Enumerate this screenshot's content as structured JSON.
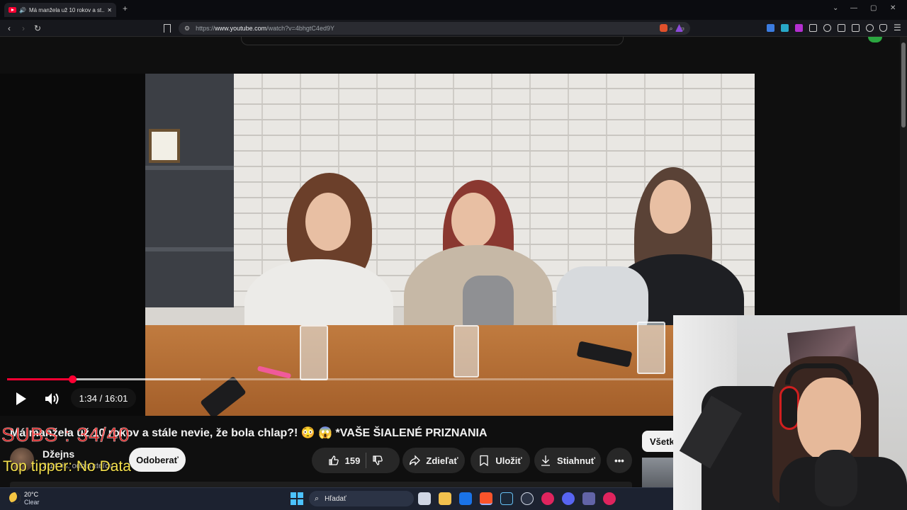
{
  "browser": {
    "tab_title": "Má manžela už 10 rokov a st...",
    "tab_close": "✕",
    "new_tab": "+",
    "url_prefix": "https://",
    "url_host": "www.youtube.com",
    "url_path": "/watch?v=4bhgtC4ed9Y",
    "window_controls": [
      "⌄",
      "—",
      "▢",
      "✕"
    ]
  },
  "player": {
    "time": "1:34 / 16:01",
    "progress": 0.098,
    "buffered": 0.29
  },
  "video": {
    "title": "Má manžela už 10 rokov a stále nevie, že bola chlap?! 😳 😱 *VAŠE ŠIALENÉ PRIZNANIA",
    "channel_name": "Džejns",
    "channel_subs": "2,14 tis. odberateľov",
    "subscribe_label": "Odoberať",
    "like_count": "159",
    "share_label": "Zdieľať",
    "save_label": "Uložiť",
    "download_label": "Stiahnuť",
    "more_label": "•••"
  },
  "sidebar": {
    "chip_all": "Všetko"
  },
  "overlay": {
    "subs_goal": "SUBS : 34/40",
    "top_tipper": "Top tipper: No Data"
  },
  "taskbar": {
    "weather_temp": "20°C",
    "weather_cond": "Clear",
    "search_placeholder": "Hľadať"
  },
  "colors": {
    "accent": "#ff0033",
    "background": "#0f0f0f",
    "pill": "#272727"
  }
}
